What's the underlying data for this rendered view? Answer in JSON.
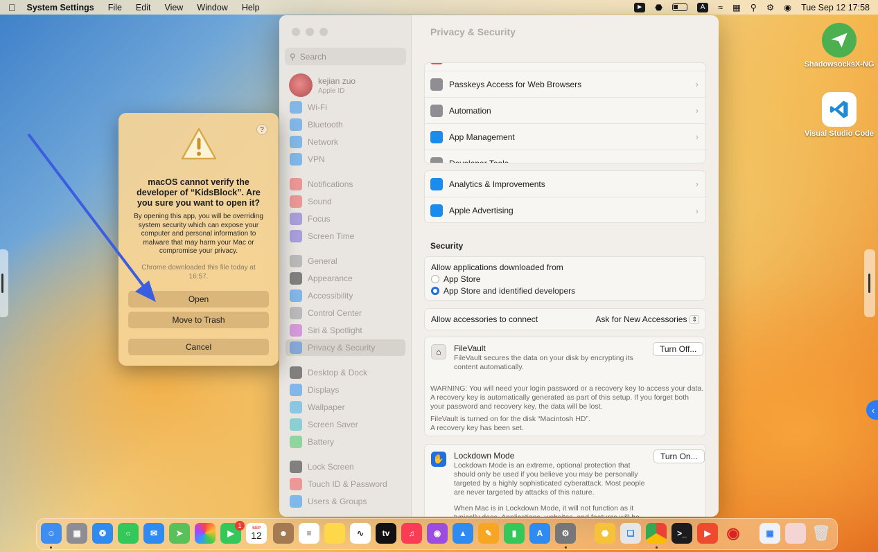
{
  "menubar": {
    "app_name": "System Settings",
    "menus": [
      "File",
      "Edit",
      "View",
      "Window",
      "Help"
    ],
    "status_a": "A",
    "clock": "Tue Sep 12  17:58"
  },
  "desktop": {
    "icons": [
      {
        "label": "ShadowsocksX-NG"
      },
      {
        "label": "Visual Studio Code"
      }
    ]
  },
  "settings": {
    "search_placeholder": "Search",
    "profile": {
      "name": "kejian zuo",
      "subtitle": "Apple ID"
    },
    "sidebar": [
      {
        "label": "Wi-Fi",
        "color": "#1a8cf0"
      },
      {
        "label": "Bluetooth",
        "color": "#1a8cf0"
      },
      {
        "label": "Network",
        "color": "#1a8cf0"
      },
      {
        "label": "VPN",
        "color": "#1a8cf0"
      },
      {
        "label": "Notifications",
        "color": "#ee4b4b"
      },
      {
        "label": "Sound",
        "color": "#ee4b4b"
      },
      {
        "label": "Focus",
        "color": "#6a5ad6"
      },
      {
        "label": "Screen Time",
        "color": "#6a5ad6"
      },
      {
        "label": "General",
        "color": "#8e8e93"
      },
      {
        "label": "Appearance",
        "color": "#1c1c1e"
      },
      {
        "label": "Accessibility",
        "color": "#1a8cf0"
      },
      {
        "label": "Control Center",
        "color": "#8e8e93"
      },
      {
        "label": "Siri & Spotlight",
        "color": "#c04fd6"
      },
      {
        "label": "Privacy & Security",
        "color": "#3a7de8"
      },
      {
        "label": "Desktop & Dock",
        "color": "#1c1c1e"
      },
      {
        "label": "Displays",
        "color": "#1a8cf0"
      },
      {
        "label": "Wallpaper",
        "color": "#2fa8e0"
      },
      {
        "label": "Screen Saver",
        "color": "#30b8c8"
      },
      {
        "label": "Battery",
        "color": "#34c759"
      },
      {
        "label": "Lock Screen",
        "color": "#1c1c1e"
      },
      {
        "label": "Touch ID & Password",
        "color": "#ee4b4b"
      },
      {
        "label": "Users & Groups",
        "color": "#1a8cf0"
      }
    ],
    "page_title": "Privacy & Security",
    "group1": [
      {
        "label": "Passkeys Access for Web Browsers",
        "color": "#8e8e93"
      },
      {
        "label": "Automation",
        "color": "#8e8e93"
      },
      {
        "label": "App Management",
        "color": "#1a8cf0"
      },
      {
        "label": "Developer Tools",
        "color": "#8e8e93"
      }
    ],
    "group2": [
      {
        "label": "Analytics & Improvements",
        "color": "#1a8cf0"
      },
      {
        "label": "Apple Advertising",
        "color": "#1a8cf0"
      }
    ],
    "security": {
      "heading": "Security",
      "allow_label": "Allow applications downloaded from",
      "options": [
        "App Store",
        "App Store and identified developers"
      ],
      "selected": 1,
      "accessories_label": "Allow accessories to connect",
      "accessories_value": "Ask for New Accessories",
      "filevault": {
        "title": "FileVault",
        "desc": "FileVault secures the data on your disk by encrypting its content automatically.",
        "button": "Turn Off...",
        "warning": "WARNING: You will need your login password or a recovery key to access your data. A recovery key is automatically generated as part of this setup. If you forget both your password and recovery key, the data will be lost.",
        "status1": "FileVault is turned on for the disk “Macintosh HD”.",
        "status2": "A recovery key has been set."
      },
      "lockdown": {
        "title": "Lockdown Mode",
        "desc": "Lockdown Mode is an extreme, optional protection that should only be used if you believe you may be personally targeted by a highly sophisticated cyberattack. Most people are never targeted by attacks of this nature.",
        "desc2": "When Mac is in Lockdown Mode, it will not function as it typically does. Applications, websites, and features will be",
        "button": "Turn On..."
      }
    }
  },
  "dialog": {
    "help": "?",
    "heading": "macOS cannot verify the developer of “KidsBlock”. Are you sure you want to open it?",
    "body": "By opening this app, you will be overriding system security which can expose your computer and personal information to malware that may harm your Mac or compromise your privacy.",
    "note": "Chrome downloaded this file today at 16:57.",
    "open_label": "Open",
    "trash_label": "Move to Trash",
    "cancel_label": "Cancel"
  },
  "dock": {
    "calendar_month": "SEP",
    "calendar_day": "12",
    "facetime_badge": "1",
    "tv_label": "tv"
  }
}
